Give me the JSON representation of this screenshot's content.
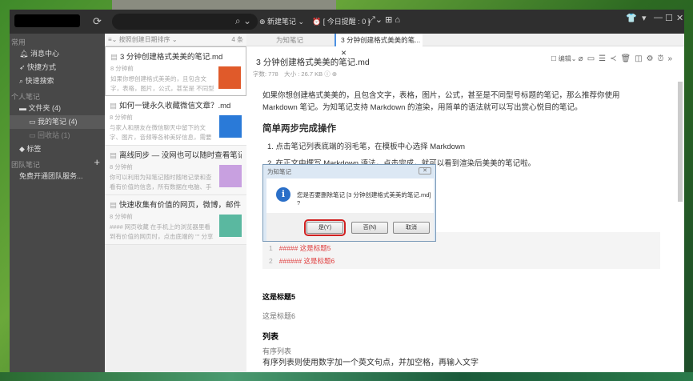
{
  "toolbar": {
    "new_note": "⊕ 新建笔记 ⌄",
    "reminder": "⏰ [ 今日提醒 : 0 ]",
    "search_icon": "search-icon"
  },
  "sidebar": {
    "sections": {
      "common": "常用",
      "personal": "个人笔记",
      "team": "团队笔记"
    },
    "items": [
      "消息中心",
      "快捷方式",
      "快速搜索"
    ],
    "folder": "文件夹 (4)",
    "my_notes": "我的笔记 (4)",
    "recycle": "回收站 (1)",
    "tags": "标签",
    "team_service": "免费开通团队服务..."
  },
  "list": {
    "sort": "按照创建日期排序 ⌄",
    "count": "4 条",
    "notes": [
      {
        "title": "3 分钟创建格式美美的笔记.md",
        "time": "8 分钟前",
        "summary": "如果你想创建格式美美的，且包含文字，表格，图片，公式，甚至是 不同型号标题的笔记...",
        "thumb": "#e05a2a"
      },
      {
        "title": "如何一键永久收藏微信文章？.md",
        "time": "8 分钟前",
        "summary": "与家人和朋友在微信聊天中留下的文字、图片，音频等各种美好信息，需要保存起来收好？...",
        "thumb": "#2a7ad8"
      },
      {
        "title": "离线同步 — 没网也可以随时查看笔记.md",
        "time": "8 分钟前",
        "summary": "你可以利用为知笔记随时随地记录和查看有价值的信息，所有数据在电脑、手机、平板、...",
        "thumb": "#c8a0e0"
      },
      {
        "title": "快速收集有价值的网页，微博，邮件！.md",
        "time": "8 分钟前",
        "summary": "#### 网页收藏 在手机上的浏览器里看到有价值的网页时，点击底端的 \"\" 分享按钮\"\" ，选...",
        "thumb": "#5ab8a0"
      }
    ]
  },
  "tabs": [
    "为知笔记",
    "3 分钟创建格式美美的笔..."
  ],
  "editor": {
    "title": "3 分钟创建格式美美的笔记.md",
    "edit": "编辑",
    "meta": "字数: 778　大小 : 26.7 KB",
    "intro": "如果你想创建格式美美的，且包含文字，表格，图片，公式，甚至是不同型号标题的笔记，那么推荐你使用Markdown 笔记。为知笔记支持 Markdown 的渲染，用简单的语法就可以写出赏心悦目的笔记。",
    "h_steps": "简单两步完成操作",
    "step1": "1. 点击笔记列表底端的羽毛笔，在模板中心选择 Markdown",
    "step2": "2. 在正文中撰写 Markdown 语法，点击完成，就可以看到渲染后美美的笔记啦。",
    "code": [
      "##### 这是标题5",
      "###### 这是标题6"
    ],
    "h5": "这是标题5",
    "h6": "这是标题6",
    "list_h": "列表",
    "ordered": "有序列表",
    "ordered_text": "有序列表则使用数字加一个英文句点，并加空格，再输入文字"
  },
  "dialog": {
    "title": "为知笔记",
    "message": "您是否要删除笔记 [3 分钟创建格式美美的笔记.md] ?",
    "yes": "是(Y)",
    "no": "否(N)",
    "cancel": "取消"
  }
}
